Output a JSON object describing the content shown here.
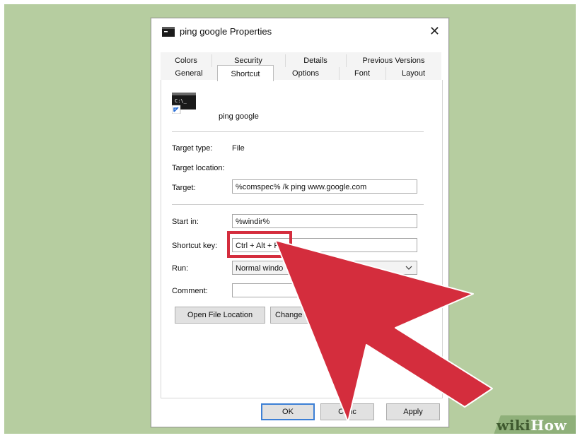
{
  "dialog": {
    "title": "ping google Properties",
    "close_glyph": "✕"
  },
  "tabs": {
    "row1": [
      "Colors",
      "Security",
      "Details",
      "Previous Versions"
    ],
    "row2": [
      "General",
      "Shortcut",
      "Options",
      "Font",
      "Layout"
    ],
    "active": "Shortcut"
  },
  "shortcut": {
    "name": "ping google",
    "target_type_label": "Target type:",
    "target_type_value": "File",
    "target_location_label": "Target location:",
    "target_label": "Target:",
    "target_value": "%comspec% /k ping www.google.com",
    "start_in_label": "Start in:",
    "start_in_value": "%windir%",
    "shortcut_key_label": "Shortcut key:",
    "shortcut_key_value": "Ctrl + Alt + P",
    "run_label": "Run:",
    "run_value": "Normal windo",
    "comment_label": "Comment:",
    "comment_value": "",
    "open_file_location_label": "Open File Location",
    "change_icon_label": "Change"
  },
  "footer": {
    "ok_label": "OK",
    "cancel_label": "Canc",
    "apply_label": "Apply"
  },
  "watermark": {
    "part1": "wiki",
    "part2": "How"
  },
  "colors": {
    "background": "#b6cda0",
    "highlight": "#d42d3d",
    "arrow_fill": "#d42d3d"
  },
  "icons": [
    "console-app-icon",
    "shortcut-arrow-icon",
    "close-icon",
    "chevron-down-icon",
    "pointer-arrow-icon"
  ]
}
